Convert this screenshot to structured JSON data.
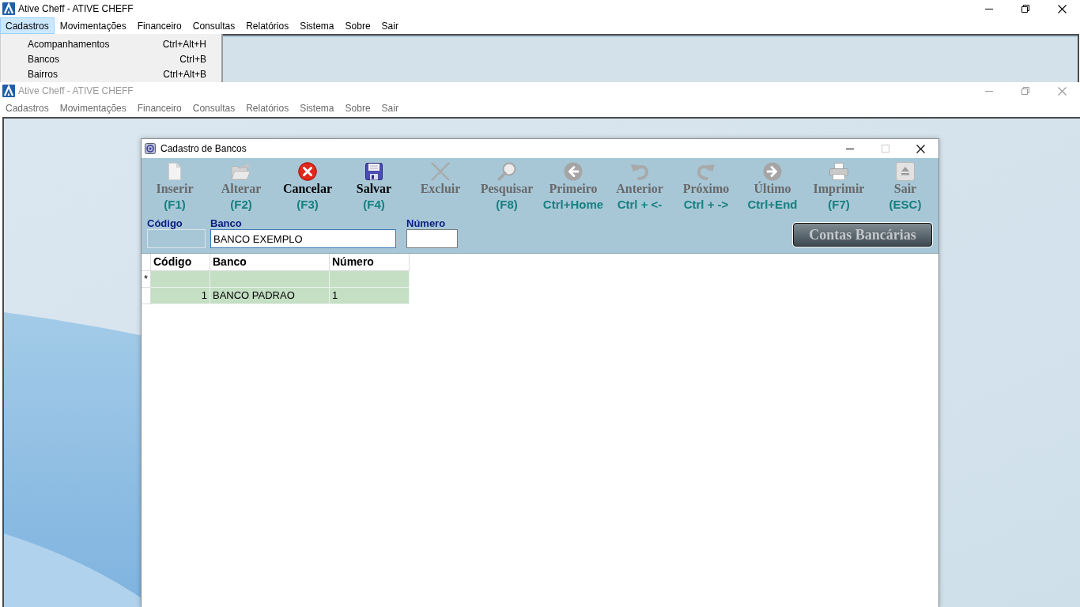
{
  "main_window": {
    "title": "Ative Cheff - ATIVE CHEFF",
    "active": true,
    "controls": [
      {
        "kind": "minimize"
      },
      {
        "kind": "restore"
      },
      {
        "kind": "close"
      }
    ],
    "menu": [
      {
        "label": "Cadastros",
        "selected": true
      },
      {
        "label": "Movimentações",
        "selected": false
      },
      {
        "label": "Financeiro",
        "selected": false
      },
      {
        "label": "Consultas",
        "selected": false
      },
      {
        "label": "Relatórios",
        "selected": false
      },
      {
        "label": "Sistema",
        "selected": false
      },
      {
        "label": "Sobre",
        "selected": false
      },
      {
        "label": "Sair",
        "selected": false
      }
    ],
    "dropdown": [
      {
        "label": "Acompanhamentos",
        "shortcut": "Ctrl+Alt+H",
        "selected": false
      },
      {
        "label": "Bancos",
        "shortcut": "Ctrl+B",
        "selected": false
      },
      {
        "label": "Bairros",
        "shortcut": "Ctrl+Alt+B",
        "selected": false
      }
    ]
  },
  "second_window": {
    "title": "Ative Cheff - ATIVE CHEFF",
    "active": false,
    "controls": [
      {
        "kind": "minimize"
      },
      {
        "kind": "restore"
      },
      {
        "kind": "close"
      }
    ],
    "menu": [
      {
        "label": "Cadastros",
        "selected": false
      },
      {
        "label": "Movimentações",
        "selected": false
      },
      {
        "label": "Financeiro",
        "selected": false
      },
      {
        "label": "Consultas",
        "selected": false
      },
      {
        "label": "Relatórios",
        "selected": false
      },
      {
        "label": "Sistema",
        "selected": false
      },
      {
        "label": "Sobre",
        "selected": false
      },
      {
        "label": "Sair",
        "selected": false
      }
    ]
  },
  "child_window": {
    "title": "Cadastro de Bancos",
    "controls": [
      {
        "kind": "minimize",
        "disabled": false
      },
      {
        "kind": "maximize",
        "disabled": true
      },
      {
        "kind": "close",
        "disabled": false
      }
    ],
    "toolbar": [
      {
        "kind": "new",
        "label": "Inserir",
        "shortcut": "(F1)",
        "disabled": true
      },
      {
        "kind": "edit",
        "label": "Alterar",
        "shortcut": "(F2)",
        "disabled": true
      },
      {
        "kind": "cancel",
        "label": "Cancelar",
        "shortcut": "(F3)",
        "disabled": false
      },
      {
        "kind": "save",
        "label": "Salvar",
        "shortcut": "(F4)",
        "disabled": false
      },
      {
        "kind": "delete",
        "label": "Excluir",
        "disabled": true
      },
      {
        "kind": "search",
        "label": "Pesquisar",
        "shortcut": "(F8)",
        "disabled": true
      },
      {
        "kind": "first",
        "label": "Primeiro",
        "shortcut": "Ctrl+Home",
        "disabled": true
      },
      {
        "kind": "previous",
        "label": "Anterior",
        "shortcut": "Ctrl + <-",
        "disabled": true
      },
      {
        "kind": "next",
        "label": "Próximo",
        "shortcut": "Ctrl + ->",
        "disabled": true
      },
      {
        "kind": "last",
        "label": "Último",
        "shortcut": "Ctrl+End",
        "disabled": true
      },
      {
        "kind": "print",
        "label": "Imprimir",
        "shortcut": "(F7)",
        "disabled": true
      },
      {
        "kind": "exit",
        "label": "Sair",
        "shortcut": "(ESC)",
        "disabled": true
      }
    ],
    "fields": [
      {
        "label": "Código",
        "disabled": true,
        "focused": false
      },
      {
        "label": "Banco",
        "value": "BANCO EXEMPLO",
        "disabled": false,
        "focused": true
      },
      {
        "label": "Número",
        "disabled": false,
        "focused": false
      }
    ],
    "side_button": {
      "label": "Contas Bancárias",
      "disabled": true
    },
    "grid": {
      "columns": [
        {
          "label": "Código",
          "right_aligned": true
        },
        {
          "label": "Banco",
          "right_aligned": false
        },
        {
          "label": "Número",
          "right_aligned": false
        }
      ],
      "rows": [
        {
          "indicator": "*"
        },
        {
          "cells": [
            "1",
            "BANCO PADRAO",
            "1"
          ]
        }
      ]
    }
  }
}
